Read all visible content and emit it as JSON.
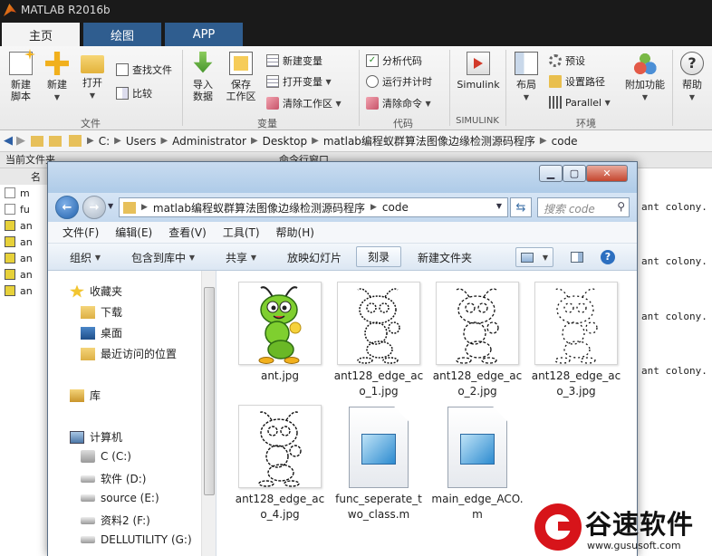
{
  "app": {
    "title": "MATLAB R2016b"
  },
  "ribbon": {
    "tabs": [
      {
        "label": "主页",
        "active": true
      },
      {
        "label": "绘图",
        "active": false
      },
      {
        "label": "APP",
        "active": false
      }
    ],
    "file": {
      "new_script": "新建\n脚本",
      "new": "新建",
      "open": "打开",
      "find_files": "查找文件",
      "compare": "比较",
      "group": "文件"
    },
    "variable": {
      "import": "导入\n数据",
      "save_workspace": "保存\n工作区",
      "new_variable": "新建变量",
      "open_variable": "打开变量",
      "clear_workspace": "清除工作区",
      "group": "变量"
    },
    "code": {
      "analyze": "分析代码",
      "run_and_time": "运行并计时",
      "clear_commands": "清除命令",
      "group": "代码"
    },
    "simulink": {
      "label": "Simulink",
      "group": "SIMULINK"
    },
    "environment": {
      "layout": "布局",
      "preferences": "预设",
      "set_path": "设置路径",
      "parallel": "Parallel",
      "addons": "附加功能",
      "group": "环境"
    },
    "help": "帮助"
  },
  "address_bar": {
    "segments": [
      "C:",
      "Users",
      "Administrator",
      "Desktop",
      "matlab编程蚁群算法图像边缘检测源码程序",
      "code"
    ]
  },
  "panels": {
    "current_folder": "当前文件夹",
    "command_window": "命令行窗口",
    "name_col": "名",
    "files": [
      "m",
      "fu",
      "an",
      "an",
      "an",
      "an",
      "an"
    ],
    "cmd_lines": [
      "ant colony.",
      "ant colony.",
      "ant colony.",
      "ant colony."
    ]
  },
  "explorer": {
    "path": [
      "matlab编程蚁群算法图像边缘检测源码程序",
      "code"
    ],
    "search_placeholder": "搜索 code",
    "menu": [
      "文件(F)",
      "编辑(E)",
      "查看(V)",
      "工具(T)",
      "帮助(H)"
    ],
    "cmdbar": {
      "organize": "组织",
      "include_in_library": "包含到库中",
      "share": "共享",
      "slideshow": "放映幻灯片",
      "burn": "刻录",
      "new_folder": "新建文件夹"
    },
    "nav": {
      "favorites": "收藏夹",
      "downloads": "下载",
      "desktop": "桌面",
      "recent": "最近访问的位置",
      "library": "库",
      "computer": "计算机",
      "drive_c": "C (C:)",
      "drive_d": "软件 (D:)",
      "drive_e": "source (E:)",
      "drive_f": "资料2 (F:)",
      "drive_g": "DELLUTILITY (G:)"
    },
    "files": [
      "ant.jpg",
      "ant128_edge_aco_1.jpg",
      "ant128_edge_aco_2.jpg",
      "ant128_edge_aco_3.jpg",
      "ant128_edge_aco_4.jpg",
      "func_seperate_two_class.m",
      "main_edge_ACO.m"
    ]
  },
  "watermark": {
    "name": "谷速软件",
    "url": "www.gususoft.com"
  },
  "colors": {
    "ribbon_tab": "#2f5d8f",
    "explorer_frame": "#b9d1ea",
    "watermark_red": "#d7141a"
  }
}
